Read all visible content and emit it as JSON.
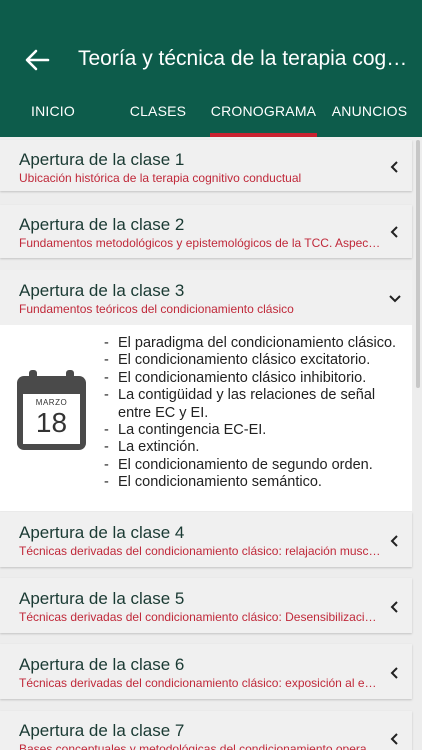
{
  "header": {
    "title": "Teoría y técnica de la terapia cognitivo conductual",
    "back_icon": "arrow-left-icon"
  },
  "tabs": [
    {
      "label": "INICIO"
    },
    {
      "label": "CLASES"
    },
    {
      "label": "CRONOGRAMA",
      "active": true
    },
    {
      "label": "ANUNCIOS"
    }
  ],
  "classes": [
    {
      "title": "Apertura de la clase 1",
      "subtitle": "Ubicación histórica de la terapia cognitivo conductual"
    },
    {
      "title": "Apertura de la clase 2",
      "subtitle": "Fundamentos metodológicos y epistemológicos de la TCC. Aspectos generales"
    },
    {
      "title": "Apertura de la clase 3",
      "subtitle": "Fundamentos teóricos del condicionamiento clásico",
      "expanded": true,
      "date": {
        "month": "MARZO",
        "day": "18"
      },
      "topics": [
        "El paradigma del condicionamiento clásico.",
        "El condicionamiento clásico excitatorio.",
        "El condicionamiento clásico inhibitorio.",
        "La contigüidad y las relaciones de señal entre EC y EI.",
        "La contingencia EC-EI.",
        "La extinción.",
        "El condicionamiento de segundo orden.",
        "El condicionamiento semántico."
      ]
    },
    {
      "title": "Apertura de la clase 4",
      "subtitle": "Técnicas derivadas del condicionamiento clásico: relajación muscular progresiva"
    },
    {
      "title": "Apertura de la clase 5",
      "subtitle": "Técnicas derivadas del condicionamiento clásico: Desensibilización sistemática"
    },
    {
      "title": "Apertura de la clase 6",
      "subtitle": "Técnicas derivadas del condicionamiento clásico: exposición al estímulo"
    },
    {
      "title": "Apertura de la clase 7",
      "subtitle": "Bases conceptuales y metodológicas del condicionamiento operante"
    }
  ],
  "colors": {
    "appbar": "#0d5c4b",
    "accent": "#c8202f",
    "subtitle": "#c0293a"
  }
}
